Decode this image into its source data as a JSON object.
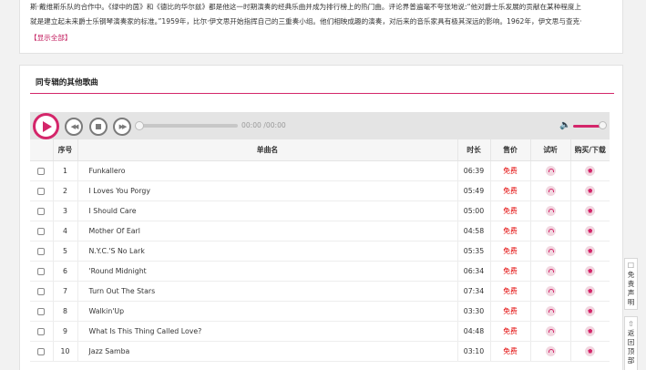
{
  "album_intro": {
    "line1": "斯·戴维斯乐队的合作中。《绿中的茵》和《德比的华尔兹》都是他这一时期演奏的经典乐曲并成为排行榜上的热门曲。评论界普遍毫不夸张地说:“他对爵士乐发展的贡献在某种程度上",
    "line2": "就是建立起未来爵士乐钢琴演奏家的标准。”1959年，比尔·伊文思开始指挥自己的三重奏小组。他们相映成趣的演奏，对后来的音乐家具有极其深远的影响。1962年，伊文思与查克·",
    "show_all": "【显示全部】"
  },
  "panel": {
    "title": "同专辑的其他歌曲"
  },
  "player": {
    "time": "00:00 /00:00",
    "progress": 0,
    "volume": 0.95,
    "icons": {
      "play": "play-icon",
      "prev": "rewind-icon",
      "stop": "stop-icon",
      "next": "fast-forward-icon",
      "volume": "speaker-icon"
    },
    "colors": {
      "accent": "#d4266a",
      "control": "#7b7b7b"
    }
  },
  "table": {
    "headers": [
      "",
      "序号",
      "单曲名",
      "时长",
      "售价",
      "试听",
      "购买/下载"
    ],
    "rows": [
      {
        "no": "1",
        "title": "Funkallero",
        "duration": "06:39",
        "price": "免费"
      },
      {
        "no": "2",
        "title": "I Loves You Porgy",
        "duration": "05:49",
        "price": "免费"
      },
      {
        "no": "3",
        "title": "I Should Care",
        "duration": "05:00",
        "price": "免费"
      },
      {
        "no": "4",
        "title": "Mother Of Earl",
        "duration": "04:58",
        "price": "免费"
      },
      {
        "no": "5",
        "title": "N.Y.C.'S No Lark",
        "duration": "05:35",
        "price": "免费"
      },
      {
        "no": "6",
        "title": "'Round Midnight",
        "duration": "06:34",
        "price": "免费"
      },
      {
        "no": "7",
        "title": "Turn Out The Stars",
        "duration": "07:34",
        "price": "免费"
      },
      {
        "no": "8",
        "title": "Walkin'Up",
        "duration": "03:30",
        "price": "免费"
      },
      {
        "no": "9",
        "title": "What Is This Thing Called Love?",
        "duration": "04:48",
        "price": "免费"
      },
      {
        "no": "10",
        "title": "Jazz Samba",
        "duration": "03:10",
        "price": "免费"
      }
    ],
    "colors": {
      "price": "#e10000"
    }
  },
  "side_tabs": {
    "disclaimer": "免责声明",
    "back_to_top": "返回顶部"
  }
}
